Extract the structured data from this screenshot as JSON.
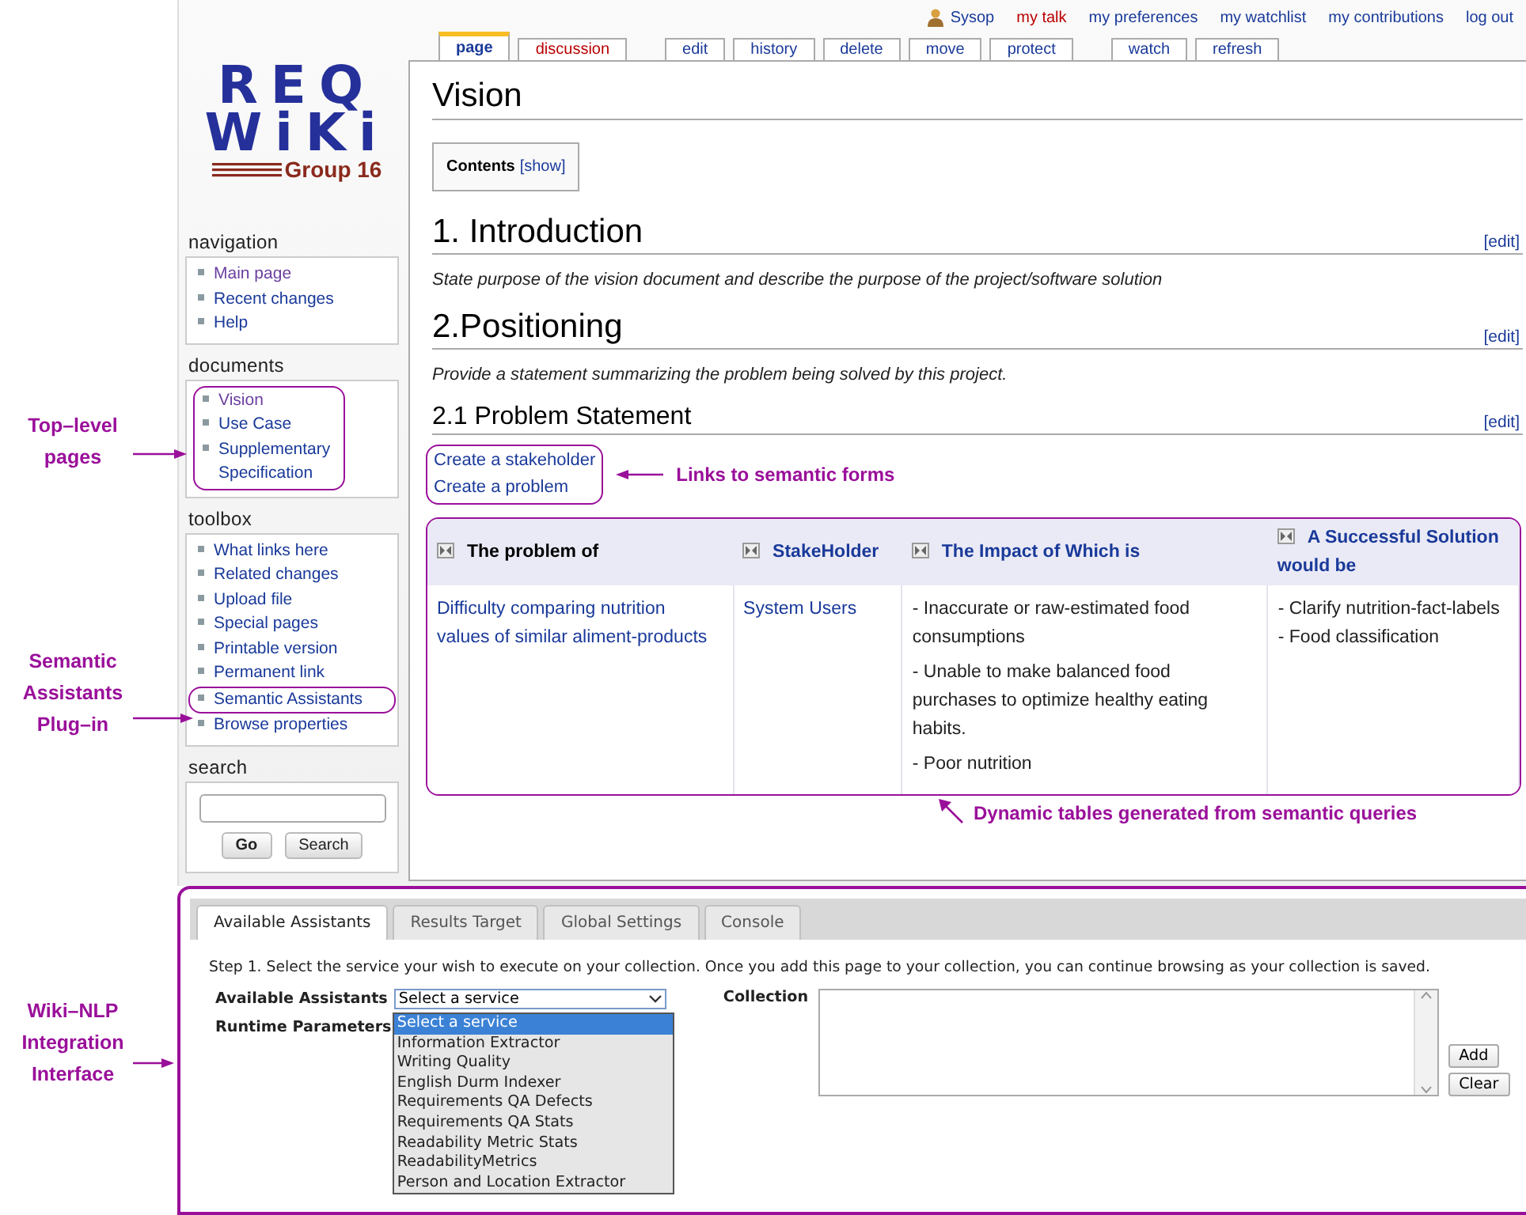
{
  "user_bar": {
    "user": "Sysop",
    "links": [
      {
        "label": "my talk",
        "missing": true
      },
      {
        "label": "my preferences",
        "missing": false
      },
      {
        "label": "my watchlist",
        "missing": false
      },
      {
        "label": "my contributions",
        "missing": false
      },
      {
        "label": "log out",
        "missing": false
      }
    ]
  },
  "page_tab_groups": [
    {
      "tabs": [
        {
          "label": "page",
          "selected": true,
          "missing": false
        },
        {
          "label": "discussion",
          "selected": false,
          "missing": true
        }
      ]
    },
    {
      "tabs": [
        {
          "label": "edit",
          "selected": false,
          "missing": false
        },
        {
          "label": "history",
          "selected": false,
          "missing": false
        },
        {
          "label": "delete",
          "selected": false,
          "missing": false
        },
        {
          "label": "move",
          "selected": false,
          "missing": false
        },
        {
          "label": "protect",
          "selected": false,
          "missing": false
        }
      ]
    },
    {
      "tabs": [
        {
          "label": "watch",
          "selected": false,
          "missing": false
        },
        {
          "label": "refresh",
          "selected": false,
          "missing": false
        }
      ]
    }
  ],
  "logo": {
    "line_1": "REQ",
    "line_2": "WiKi",
    "subtitle": "Group 16"
  },
  "sidebar": [
    {
      "title": "navigation",
      "highlighted": false,
      "items": [
        {
          "label": "Main page",
          "visited": true,
          "highlighted": false
        },
        {
          "label": "Recent changes",
          "visited": false,
          "highlighted": false
        },
        {
          "label": "Help",
          "visited": false,
          "highlighted": false
        }
      ]
    },
    {
      "title": "documents",
      "highlighted": true,
      "items": [
        {
          "label": "Vision",
          "visited": true,
          "highlighted": false
        },
        {
          "label": "Use Case",
          "visited": false,
          "highlighted": false
        },
        {
          "label": "Supplementary Specification",
          "visited": false,
          "highlighted": false
        }
      ]
    },
    {
      "title": "toolbox",
      "highlighted": false,
      "items": [
        {
          "label": "What links here",
          "visited": false,
          "highlighted": false
        },
        {
          "label": "Related changes",
          "visited": false,
          "highlighted": false
        },
        {
          "label": "Upload file",
          "visited": false,
          "highlighted": false
        },
        {
          "label": "Special pages",
          "visited": false,
          "highlighted": false
        },
        {
          "label": "Printable version",
          "visited": false,
          "highlighted": false
        },
        {
          "label": "Permanent link",
          "visited": false,
          "highlighted": false
        },
        {
          "label": "Semantic Assistants",
          "visited": false,
          "highlighted": true
        },
        {
          "label": "Browse properties",
          "visited": false,
          "highlighted": false
        }
      ]
    }
  ],
  "search": {
    "title": "search",
    "buttons": [
      "Go",
      "Search"
    ]
  },
  "content": {
    "title": "Vision",
    "toc": {
      "label": "Contents",
      "toggle": "[show]"
    },
    "blocks": [
      {
        "kind": "heading",
        "text": "1. Introduction",
        "edit": "[edit]"
      },
      {
        "kind": "paragraph",
        "text": "State purpose of the vision document and describe the purpose of the project/software solution"
      },
      {
        "kind": "heading",
        "text": "2.Positioning",
        "edit": "[edit]"
      },
      {
        "kind": "paragraph",
        "text": "Provide a statement summarizing the problem being solved by this project."
      },
      {
        "kind": "subheading",
        "text": "2.1 Problem Statement",
        "edit": "[edit]"
      }
    ],
    "form_links": [
      "Create a stakeholder",
      "Create a problem"
    ],
    "form_links_note": "Links to semantic forms",
    "table": {
      "columns": [
        {
          "label": "The problem of",
          "link": false
        },
        {
          "label": "StakeHolder",
          "link": true
        },
        {
          "label": "The Impact of Which is",
          "link": true
        },
        {
          "label": "A Successful Solution would be",
          "link": true
        }
      ],
      "rows": [
        {
          "cells": [
            {
              "kind": "link",
              "lines": [
                "Difficulty comparing nutrition values of similar aliment-products"
              ]
            },
            {
              "kind": "link",
              "lines": [
                "System Users"
              ]
            },
            {
              "kind": "text",
              "lines": [
                "- Inaccurate or raw-estimated food consumptions",
                "- Unable to make balanced food purchases to optimize healthy eating habits.",
                "- Poor nutrition"
              ]
            },
            {
              "kind": "text",
              "lines": [
                "- Clarify nutrition-fact-labels",
                "- Food classification"
              ]
            }
          ]
        }
      ]
    },
    "table_note": "Dynamic tables generated from semantic queries"
  },
  "side_notes": [
    {
      "lines": [
        "Top–level",
        "pages"
      ]
    },
    {
      "lines": [
        "Semantic",
        "Assistants",
        "Plug–in"
      ]
    },
    {
      "lines": [
        "Wiki–NLP",
        "Integration",
        "Interface"
      ]
    }
  ],
  "assistant_panel": {
    "tabs": [
      {
        "label": "Available Assistants",
        "selected": true
      },
      {
        "label": "Results Target",
        "selected": false
      },
      {
        "label": "Global Settings",
        "selected": false
      },
      {
        "label": "Console",
        "selected": false
      }
    ],
    "instruction": "Step 1. Select the service your wish to execute on your collection. Once you add this page to your collection, you can continue browsing as your collection is saved.",
    "assistants_label": "Available Assistants",
    "runtime_label": "Runtime Parameters",
    "select": {
      "value": "Select a service",
      "expanded": true,
      "options": [
        {
          "label": "Select a service",
          "selected": true
        },
        {
          "label": "Information Extractor",
          "selected": false
        },
        {
          "label": "Writing Quality",
          "selected": false
        },
        {
          "label": "English Durm Indexer",
          "selected": false
        },
        {
          "label": "Requirements QA Defects",
          "selected": false
        },
        {
          "label": "Requirements QA Stats",
          "selected": false
        },
        {
          "label": "Readability Metric Stats",
          "selected": false
        },
        {
          "label": "ReadabilityMetrics",
          "selected": false
        },
        {
          "label": "Person and Location Extractor",
          "selected": false
        }
      ]
    },
    "collection_label": "Collection",
    "buttons": [
      "Add",
      "Clear"
    ]
  }
}
